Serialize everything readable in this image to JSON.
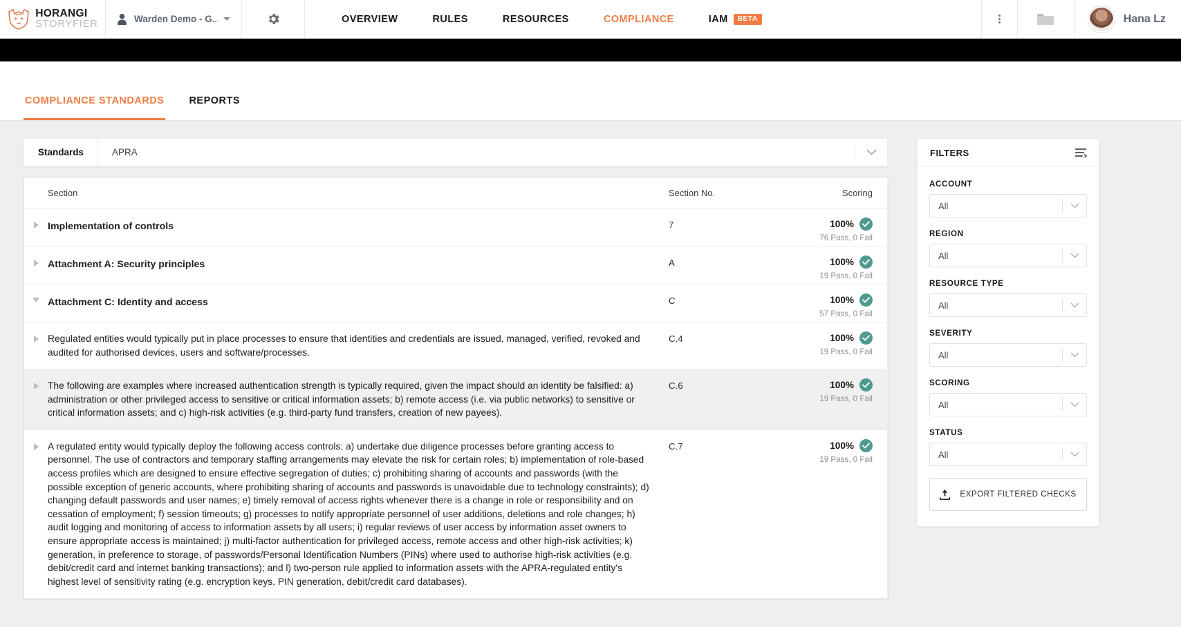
{
  "brand": {
    "line1": "HORANGI",
    "line2": "STORYFIER",
    "logo_icon": "horangi-tiger-logo"
  },
  "topnav": {
    "account_selector": {
      "value": "Warden Demo - G...",
      "icon": "person-icon",
      "caret_icon": "caret-down-icon"
    },
    "gear_icon": "gear-icon",
    "menu": [
      {
        "label": "OVERVIEW",
        "active": false
      },
      {
        "label": "RULES",
        "active": false
      },
      {
        "label": "RESOURCES",
        "active": false
      },
      {
        "label": "COMPLIANCE",
        "active": true
      },
      {
        "label": "IAM",
        "active": false,
        "badge": "BETA"
      }
    ],
    "kebab_icon": "more-vertical-icon",
    "folder_icon": "folder-icon",
    "user": {
      "name": "Hana Lz",
      "avatar_icon": "avatar"
    }
  },
  "subtabs": [
    {
      "label": "COMPLIANCE STANDARDS",
      "active": true
    },
    {
      "label": "REPORTS",
      "active": false
    }
  ],
  "standards_bar": {
    "label": "Standards",
    "value": "APRA",
    "chevron_icon": "chevron-down-icon"
  },
  "table": {
    "columns": {
      "section": "Section",
      "section_no": "Section No.",
      "scoring": "Scoring"
    },
    "rows": [
      {
        "section": "Implementation of controls",
        "section_no": "7",
        "percent": "100%",
        "detail": "76 Pass, 0 Fail",
        "bold": true,
        "expanded": false,
        "shaded": false
      },
      {
        "section": "Attachment A: Security principles",
        "section_no": "A",
        "percent": "100%",
        "detail": "19 Pass, 0 Fail",
        "bold": true,
        "expanded": false,
        "shaded": false
      },
      {
        "section": "Attachment C: Identity and access",
        "section_no": "C",
        "percent": "100%",
        "detail": "57 Pass, 0 Fail",
        "bold": true,
        "expanded": true,
        "shaded": false
      },
      {
        "section": "Regulated entities would typically put in place processes to ensure that identities and credentials are issued, managed, verified, revoked and audited for authorised devices, users and software/processes.",
        "section_no": "C.4",
        "percent": "100%",
        "detail": "19 Pass, 0 Fail",
        "bold": false,
        "expanded": false,
        "shaded": false
      },
      {
        "section": "The following are examples where increased authentication strength is typically required, given the impact should an identity be falsified: a) administration or other privileged access to sensitive or critical information assets; b) remote access (i.e. via public networks) to sensitive or critical information assets; and c) high-risk activities (e.g. third-party fund transfers, creation of new payees).",
        "section_no": "C.6",
        "percent": "100%",
        "detail": "19 Pass, 0 Fail",
        "bold": false,
        "expanded": false,
        "shaded": true
      },
      {
        "section": "A regulated entity would typically deploy the following access controls: a) undertake due diligence processes before granting access to personnel. The use of contractors and temporary staffing arrangements may elevate the risk for certain roles; b) implementation of role-based access profiles which are designed to ensure effective segregation of duties; c) prohibiting sharing of accounts and passwords (with the possible exception of generic accounts, where prohibiting sharing of accounts and passwords is unavoidable due to technology constraints); d) changing default passwords and user names; e) timely removal of access rights whenever there is a change in role or responsibility and on cessation of employment; f) session timeouts; g) processes to notify appropriate personnel of user additions, deletions and role changes; h) audit logging and monitoring of access to information assets by all users; i) regular reviews of user access by information asset owners to ensure appropriate access is maintained; j) multi-factor authentication for privileged access, remote access and other high-risk activities; k) generation, in preference to storage, of passwords/Personal Identification Numbers (PINs) where used to authorise high-risk activities (e.g. debit/credit card and internet banking transactions); and l) two-person rule applied to information assets with the APRA-regulated entity's highest level of sensitivity rating (e.g. encryption keys, PIN generation, debit/credit card databases).",
        "section_no": "C.7",
        "percent": "100%",
        "detail": "19 Pass, 0 Fail",
        "bold": false,
        "expanded": false,
        "shaded": false
      }
    ]
  },
  "filters": {
    "title": "FILTERS",
    "settings_icon": "filter-settings-icon",
    "groups": [
      {
        "label": "ACCOUNT",
        "value": "All"
      },
      {
        "label": "REGION",
        "value": "All"
      },
      {
        "label": "RESOURCE TYPE",
        "value": "All"
      },
      {
        "label": "SEVERITY",
        "value": "All"
      },
      {
        "label": "SCORING",
        "value": "All"
      },
      {
        "label": "STATUS",
        "value": "All"
      }
    ],
    "export_button": {
      "label": "EXPORT FILTERED CHECKS",
      "icon": "upload-icon"
    }
  },
  "colors": {
    "accent": "#ef7d45",
    "pass": "#4f9a8f",
    "text": "#17171a"
  }
}
